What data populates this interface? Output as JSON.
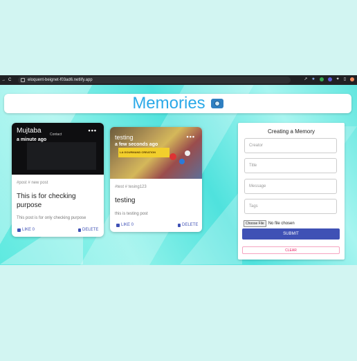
{
  "browser": {
    "url": "eloquent-beignet-f03ad6.netlify.app"
  },
  "app": {
    "title": "Memories"
  },
  "posts": [
    {
      "creator": "Mujtaba",
      "time": "a minute ago",
      "tags": "#post # new post",
      "title": "This is for checking purpose",
      "message": "This post is for only checking purpose",
      "like_label": "LIKE 0",
      "delete_label": "DELETE",
      "image_caption": "Contact"
    },
    {
      "creator": "testing",
      "time": "a few seconds ago",
      "tags": "#test # tesing123",
      "title": "testing",
      "message": "this is testing post",
      "like_label": "LIKE 0",
      "delete_label": "DELETE",
      "image_caption": "LA GOURMAND CREATION"
    }
  ],
  "form": {
    "title": "Creating a Memory",
    "creator_placeholder": "Creator",
    "title_placeholder": "Title",
    "message_placeholder": "Message",
    "tags_placeholder": "Tags",
    "file_button": "Choose File",
    "file_status": "No file chosen",
    "submit_label": "SUBMIT",
    "clear_label": "CLEAR"
  },
  "colors": {
    "accent": "#3f51b5",
    "title": "#2ba9e8",
    "clear": "#e91e63"
  }
}
